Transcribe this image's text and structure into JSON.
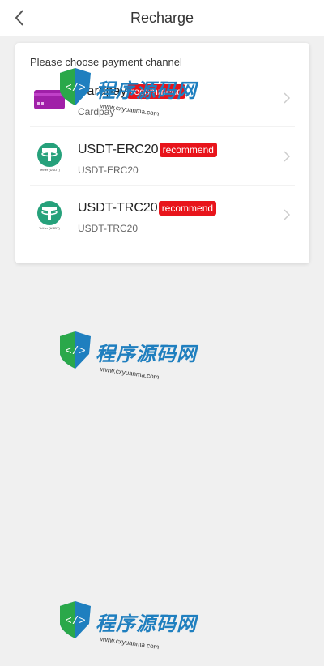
{
  "header": {
    "title": "Recharge"
  },
  "card": {
    "title": "Please choose payment channel"
  },
  "channels": [
    {
      "name": "Cardpay",
      "badge": "recommend",
      "subtitle": "Cardpay",
      "icon": "card-icon",
      "color": "#a020a8"
    },
    {
      "name": "USDT-ERC20",
      "badge": "recommend",
      "subtitle": "USDT-ERC20",
      "icon": "tether-icon",
      "icon_label": "Tether (USDT)",
      "color": "#26a17b"
    },
    {
      "name": "USDT-TRC20",
      "badge": "recommend",
      "subtitle": "USDT-TRC20",
      "icon": "tether-icon",
      "icon_label": "Tether (USDT)",
      "color": "#26a17b"
    }
  ],
  "watermark": {
    "brand": "程序源码网",
    "url": "www.cxyuanma.com"
  },
  "colors": {
    "badge": "#e8141b",
    "background": "#f0f0f0"
  }
}
